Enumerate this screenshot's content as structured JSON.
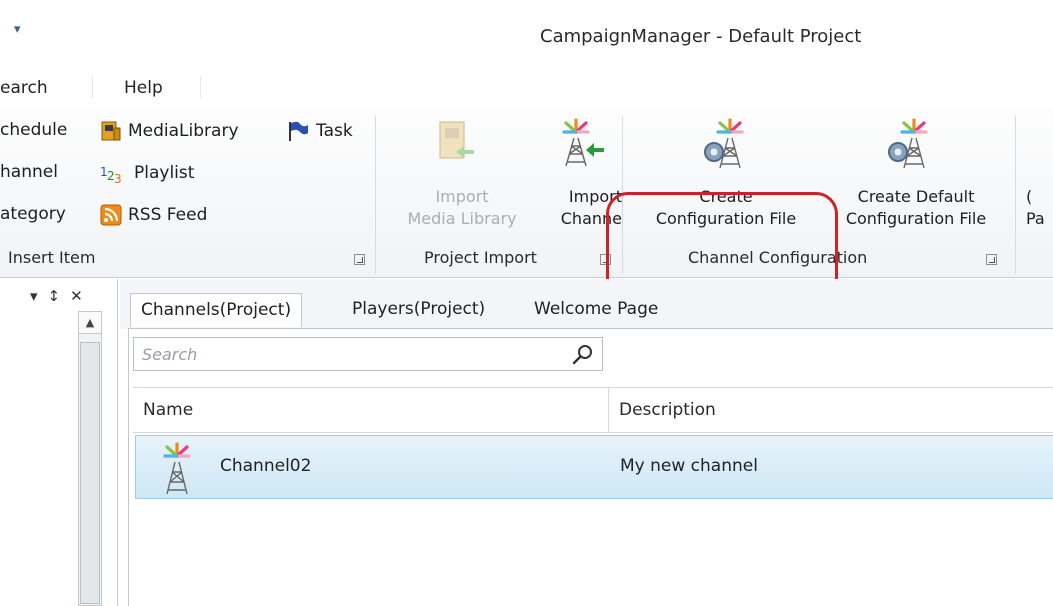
{
  "window": {
    "qat_glyph": "▾",
    "title": "CampaignManager - Default Project"
  },
  "menu": [
    {
      "label": "earch"
    },
    {
      "label": "Help"
    }
  ],
  "ribbon": {
    "insert_group": {
      "items": [
        {
          "label": "chedule",
          "icon": "schedule-icon"
        },
        {
          "label": "MediaLibrary",
          "icon": "media-library-icon"
        },
        {
          "label": "Task",
          "icon": "flag-icon"
        },
        {
          "label": "hannel",
          "icon": "channel-icon"
        },
        {
          "label": "Playlist",
          "icon": "playlist-icon"
        },
        {
          "label": "ategory",
          "icon": "category-icon"
        },
        {
          "label": "RSS Feed",
          "icon": "rss-icon"
        }
      ],
      "label": "Insert Item"
    },
    "import_group": {
      "buttons": [
        {
          "line1": "Import",
          "line2": "Media Library",
          "enabled": false
        },
        {
          "line1": "Import",
          "line2": "Channe",
          "enabled": true
        }
      ],
      "label": "Project Import"
    },
    "config_group": {
      "buttons": [
        {
          "line1": "Create",
          "line2": "Configuration File"
        },
        {
          "line1": "Create Default",
          "line2": "Configuration File"
        }
      ],
      "label": "Channel Configuration"
    },
    "cut_button": {
      "line1": "(",
      "line2": "Pa"
    }
  },
  "left_pane": {
    "tools": [
      "▾",
      "↕",
      "✕"
    ],
    "scroll_up_glyph": "▲"
  },
  "tabs": [
    {
      "label": "Channels(Project)",
      "active": true
    },
    {
      "label": "Players(Project)",
      "active": false
    },
    {
      "label": "Welcome Page",
      "active": false
    }
  ],
  "search": {
    "placeholder": "Search",
    "value": ""
  },
  "grid": {
    "columns": [
      "Name",
      "Description"
    ],
    "rows": [
      {
        "name": "Channel02",
        "description": "My new channel",
        "icon": "channel-tower-icon"
      }
    ]
  },
  "colors": {
    "highlight": "#d0202a",
    "row_selected": "#cfe7f5",
    "accent": "#3d5f8e"
  }
}
